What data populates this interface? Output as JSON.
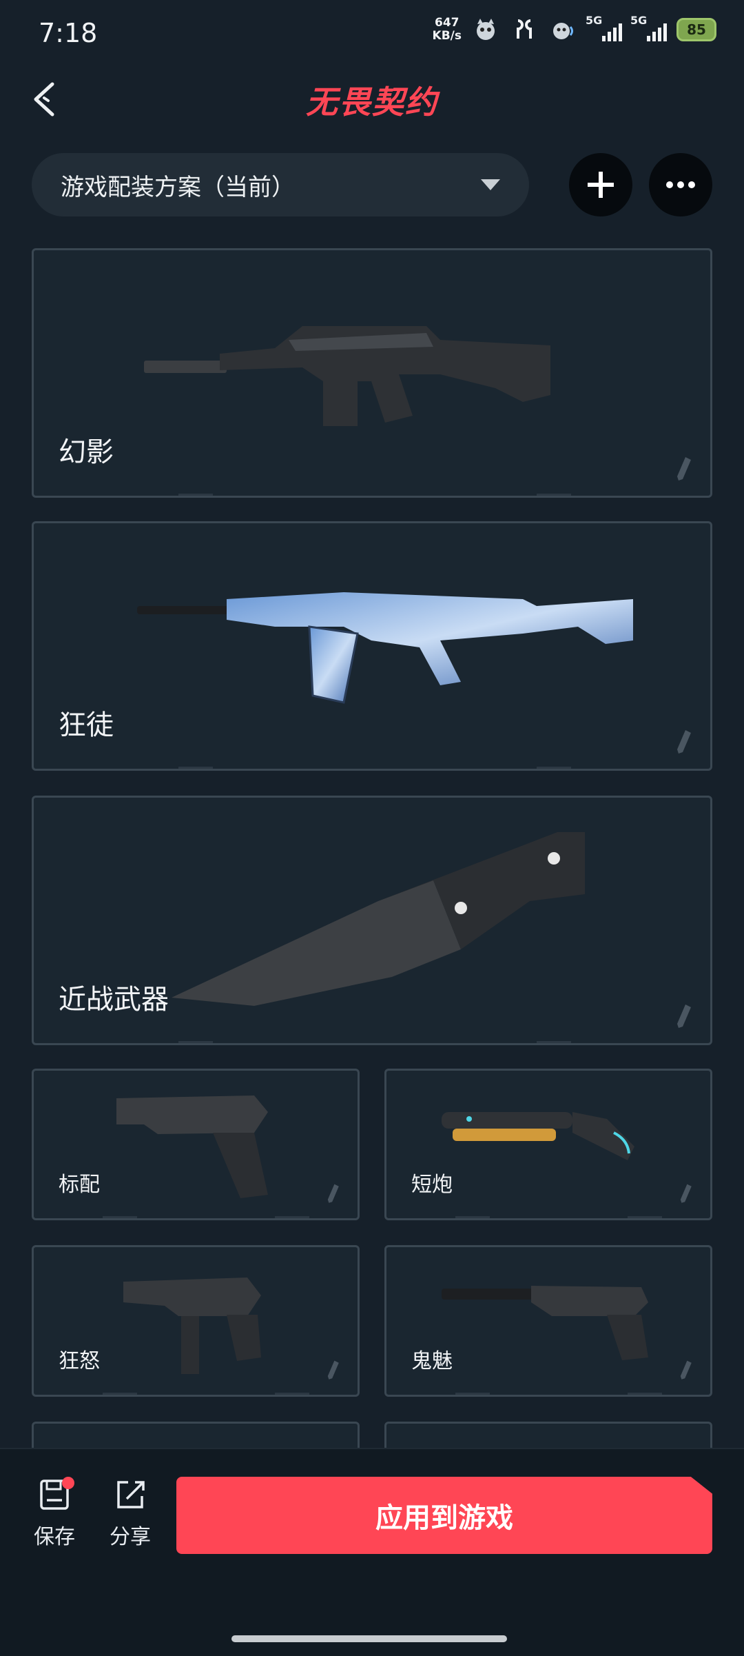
{
  "status": {
    "time": "7:18",
    "net_speed_value": "647",
    "net_speed_unit": "KB/s",
    "sim1": "5G",
    "sim2": "5G",
    "battery": "85"
  },
  "header": {
    "title": "无畏契约"
  },
  "loadout": {
    "selected": "游戏配装方案（当前）"
  },
  "weapons": {
    "phantom": "幻影",
    "vandal": "狂徒",
    "melee": "近战武器",
    "classic": "标配",
    "shorty": "短炮",
    "frenzy": "狂怒",
    "ghost": "鬼魅"
  },
  "bottom": {
    "save": "保存",
    "share": "分享",
    "apply": "应用到游戏"
  },
  "colors": {
    "accent": "#ff4655",
    "background": "#16202a",
    "card": "#1a2630"
  }
}
